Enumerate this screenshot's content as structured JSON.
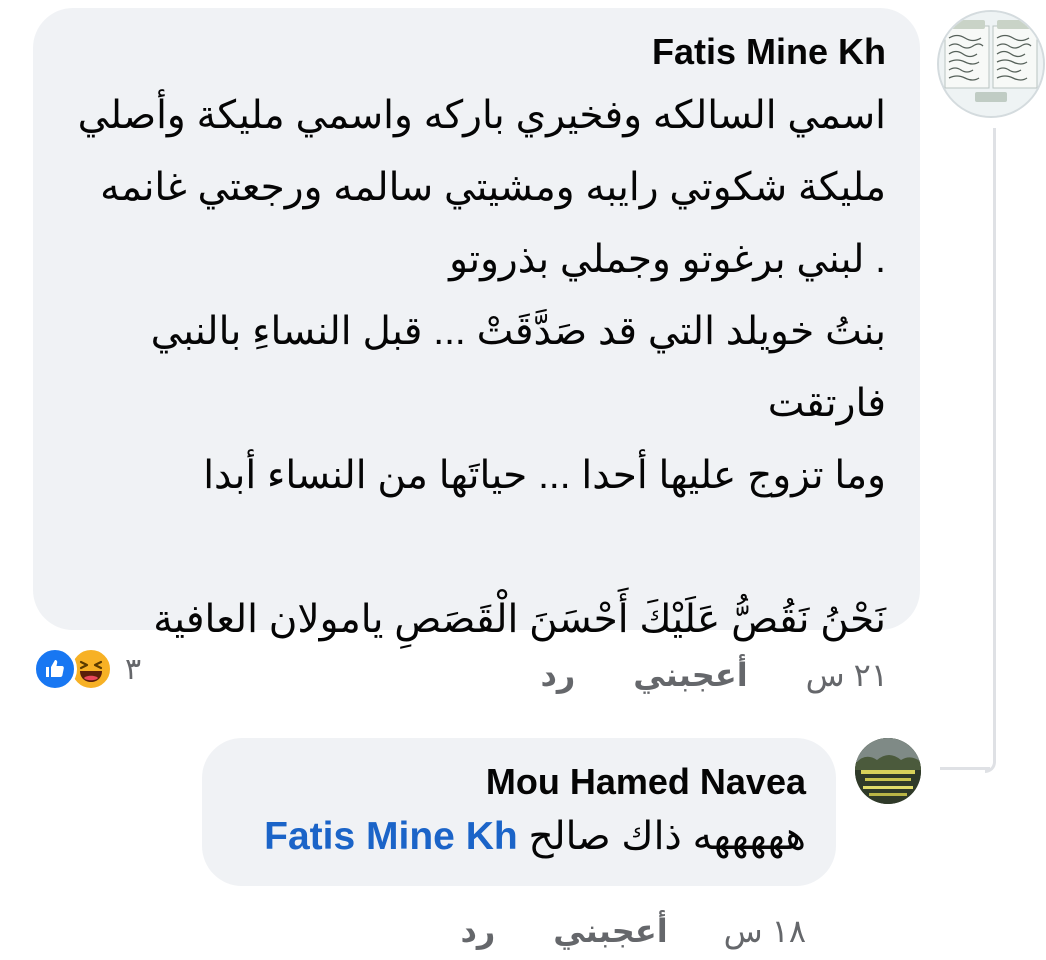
{
  "colors": {
    "bubble_bg": "#f0f2f5",
    "mention": "#1b64c8",
    "meta_text": "#65676b",
    "like_reaction": "#1877f2",
    "haha_reaction": "#f7b125"
  },
  "comments": [
    {
      "author": "Fatis Mine Kh",
      "lines": [
        "اسمي السالكه وفخيري باركه واسمي مليكة وأصلي",
        "مليكة شكوتي رايبه ومشيتي سالمه ورجعتي غانمه",
        ". لبني برغوتو وجملي بذروتو",
        "بنتُ خويلد التي قد صَدَّقَتْ ... قبل النساءِ بالنبي",
        "فارتقت",
        "وما تزوج عليها أحدا ... حياتَها من النساء أبدا",
        "",
        "نَحْنُ نَقُصُّ عَلَيْكَ أَحْسَنَ الْقَصَصِ يامولان العافية"
      ],
      "reactions": {
        "icons": [
          "like-icon",
          "haha-icon"
        ],
        "count": "٣"
      },
      "actions": {
        "time": "٢١ س",
        "like": "أعجبني",
        "reply": "رد"
      }
    },
    {
      "author": "Mou Hamed Navea",
      "text": "هههههه ذاك صالح",
      "mention": "Fatis Mine Kh",
      "actions": {
        "time": "١٨ س",
        "like": "أعجبني",
        "reply": "رد"
      }
    }
  ]
}
